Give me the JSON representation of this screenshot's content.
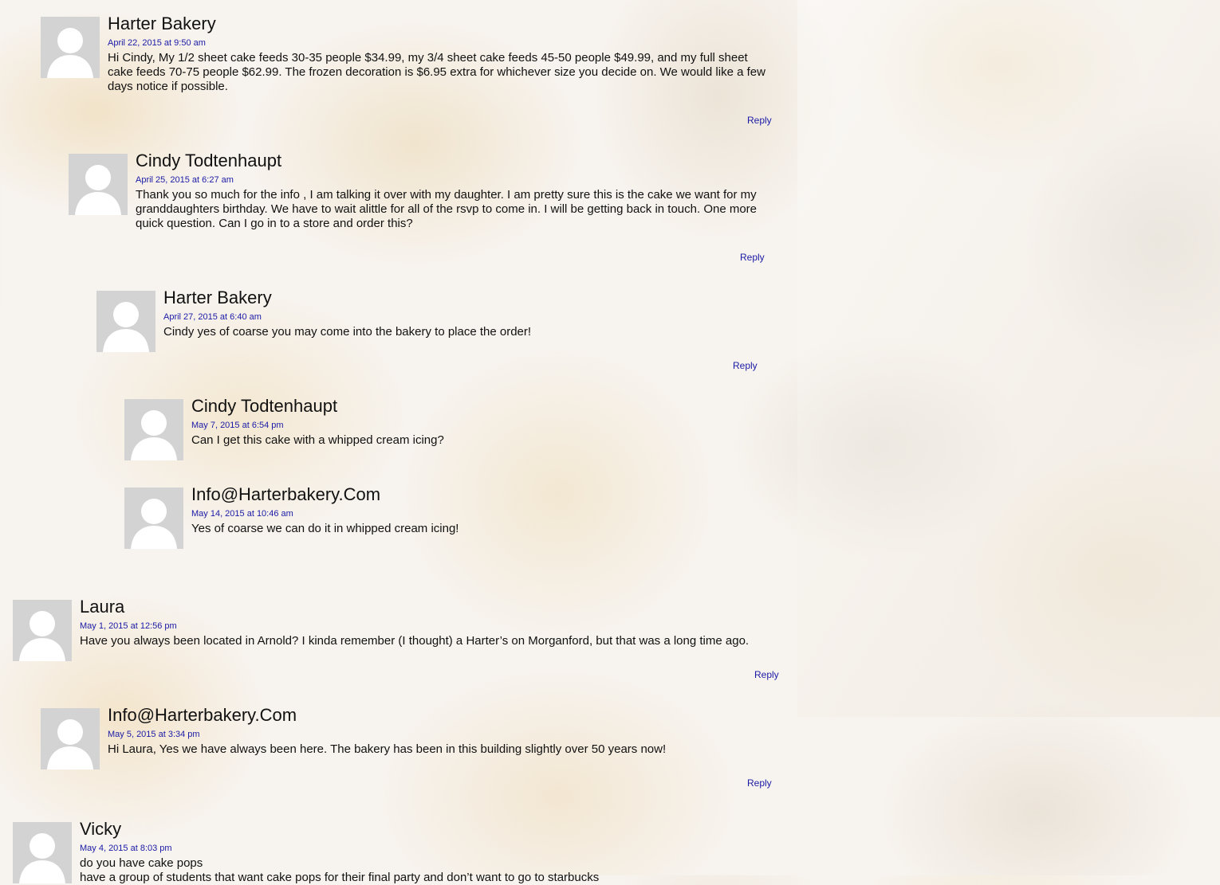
{
  "reply_label": "Reply",
  "comments": [
    {
      "author": "Harter Bakery",
      "date": "April 22, 2015 at 9:50 am",
      "text": "Hi Cindy, My 1/2 sheet cake feeds 30-35 people $34.99, my 3/4 sheet cake feeds 45-50 people $49.99, and my full sheet cake feeds 70-75 people $62.99. The frozen decoration is $6.95 extra for whichever size you decide on. We would like a few days notice if possible."
    },
    {
      "author": "Cindy Todtenhaupt",
      "date": "April 25, 2015 at 6:27 am",
      "text": "Thank you so much for the info , I am talking it over with my daughter. I am pretty sure this is the cake we want for my granddaughters birthday. We have to wait alittle for all of the rsvp to come in. I will be getting back in touch. One more quick question. Can I go in to a store and order this?"
    },
    {
      "author": "Harter Bakery",
      "date": "April 27, 2015 at 6:40 am",
      "text": "Cindy yes of coarse you may come into the bakery to place the order!"
    },
    {
      "author": "Cindy Todtenhaupt",
      "date": "May 7, 2015 at 6:54 pm",
      "text": "Can I get this cake with a whipped cream icing?"
    },
    {
      "author": "Info@Harterbakery.Com",
      "date": "May 14, 2015 at 10:46 am",
      "text": "Yes of coarse we can do it in whipped cream icing!"
    },
    {
      "author": "Laura",
      "date": "May 1, 2015 at 12:56 pm",
      "text": "Have you always been located in Arnold? I kinda remember (I thought) a Harter’s on Morganford, but that was a long time ago."
    },
    {
      "author": "Info@Harterbakery.Com",
      "date": "May 5, 2015 at 3:34 pm",
      "text": "Hi Laura, Yes we have always been here. The bakery has been in this building slightly over 50 years now!"
    },
    {
      "author": "Vicky",
      "date": "May 4, 2015 at 8:03 pm",
      "text": "do you have cake pops",
      "text2": "have a group of students that want cake pops for their final party and don’t want to go to starbucks"
    }
  ]
}
